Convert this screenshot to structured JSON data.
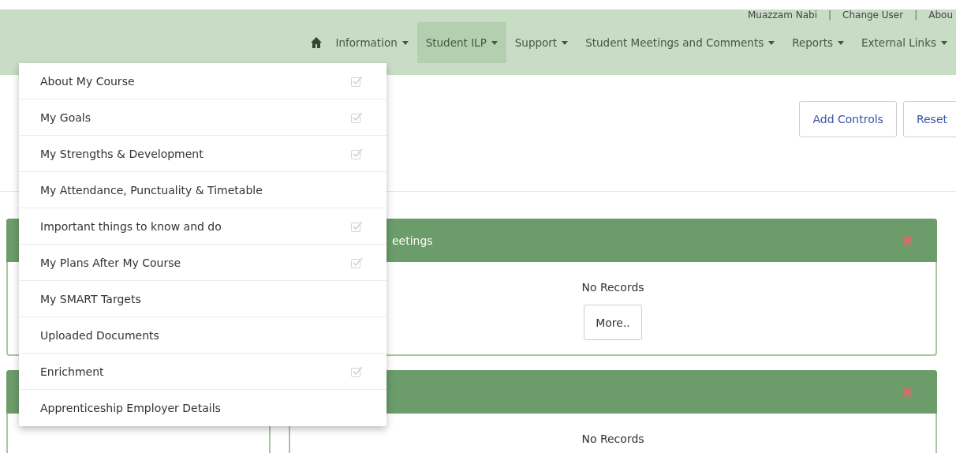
{
  "user_bar": {
    "links": [
      "Muazzam Nabi",
      "Change User",
      "Abou"
    ],
    "separator": "|"
  },
  "nav": [
    {
      "label": "Information",
      "selected": false
    },
    {
      "label": "Student ILP",
      "selected": true
    },
    {
      "label": "Support",
      "selected": false
    },
    {
      "label": "Student Meetings and Comments",
      "selected": false
    },
    {
      "label": "Reports",
      "selected": false
    },
    {
      "label": "External Links",
      "selected": false
    }
  ],
  "dropdown": [
    {
      "label": "About My Course",
      "checked": true
    },
    {
      "label": "My Goals",
      "checked": true
    },
    {
      "label": "My Strengths & Development",
      "checked": true
    },
    {
      "label": "My Attendance, Punctuality & Timetable",
      "checked": false
    },
    {
      "label": "Important things to know and do",
      "checked": true
    },
    {
      "label": "My Plans After My Course",
      "checked": true
    },
    {
      "label": "My SMART Targets",
      "checked": false
    },
    {
      "label": "Uploaded Documents",
      "checked": false
    },
    {
      "label": "Enrichment",
      "checked": true
    },
    {
      "label": "Apprenticeship Employer Details",
      "checked": false
    }
  ],
  "toolbar": {
    "buttons": [
      "Add Controls",
      "Reset"
    ]
  },
  "panels": [
    {
      "title": "eetings",
      "message": "No Records",
      "button": "More.."
    },
    {
      "message": "No Records"
    }
  ]
}
